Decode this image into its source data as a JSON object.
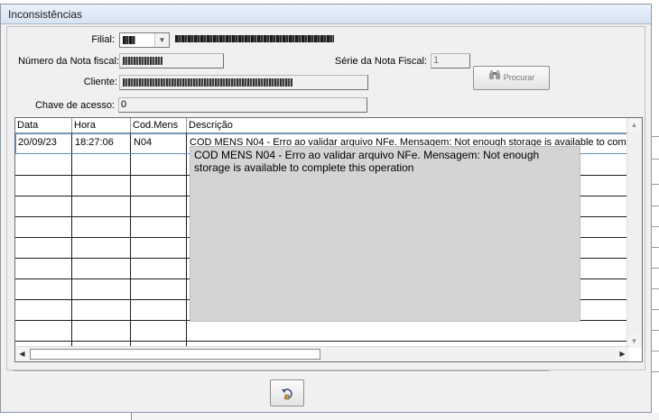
{
  "window": {
    "title": "Inconsistências"
  },
  "form": {
    "filial_label": "Filial:",
    "numero_label": "Número da Nota fiscal:",
    "serie_label": "Série da Nota Fiscal:",
    "serie_value": "1",
    "cliente_label": "Cliente:",
    "chave_label": "Chave de acesso:",
    "chave_value": "0",
    "search_button": "Procurar",
    "search_icon": "binoculars-icon"
  },
  "grid": {
    "columns": [
      "Data",
      "Hora",
      "Cod.Mens",
      "Descrição"
    ],
    "rows": [
      {
        "data": "20/09/23",
        "hora": "18:27:06",
        "cod": "N04",
        "descricao": "COD MENS N04 - Erro ao validar arquivo NFe. Mensagem: Not enough storage is available to complete this operation"
      }
    ],
    "tooltip": "COD MENS N04 - Erro ao validar arquivo NFe. Mensagem: Not enough storage is available to complete this operation"
  },
  "footer": {
    "back_icon": "undo-icon"
  },
  "colors": {
    "grid_line": "#1c1c1c",
    "selection_border": "#5b8ec6",
    "tooltip_bg": "#d4d4d4"
  }
}
